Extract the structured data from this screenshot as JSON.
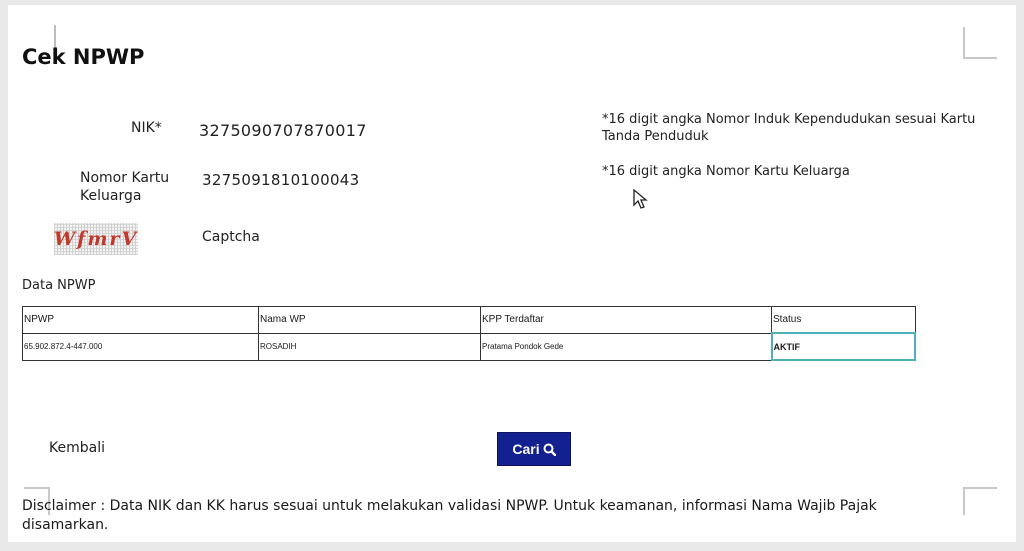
{
  "title": "Cek NPWP",
  "form": {
    "nik_label": "NIK*",
    "nik_value": "3275090707870017",
    "nik_hint": "*16 digit angka Nomor Induk Kependudukan sesuai Kartu Tanda Penduduk",
    "kk_label": "Nomor Kartu Keluarga",
    "kk_value": "3275091810100043",
    "kk_hint": "*16 digit angka Nomor Kartu Keluarga",
    "captcha_image_text": "WfmrV",
    "captcha_label": "Captcha"
  },
  "data_section": {
    "heading": "Data NPWP",
    "columns": [
      "NPWP",
      "Nama WP",
      "KPP Terdaftar",
      "Status"
    ],
    "rows": [
      [
        "65.902.872.4-447.000",
        "ROSADIH",
        "Pratama Pondok Gede",
        "AKTIF"
      ]
    ]
  },
  "actions": {
    "back_label": "Kembali",
    "search_label": "Cari",
    "search_icon": "search-icon"
  },
  "disclaimer": "Disclaimer : Data NIK dan KK harus sesuai untuk melakukan validasi NPWP. Untuk keamanan, informasi Nama Wajib Pajak disamarkan.",
  "colors": {
    "button_bg": "#13208f",
    "status_border": "#4fb1b6",
    "captcha_text": "#c0392b"
  }
}
